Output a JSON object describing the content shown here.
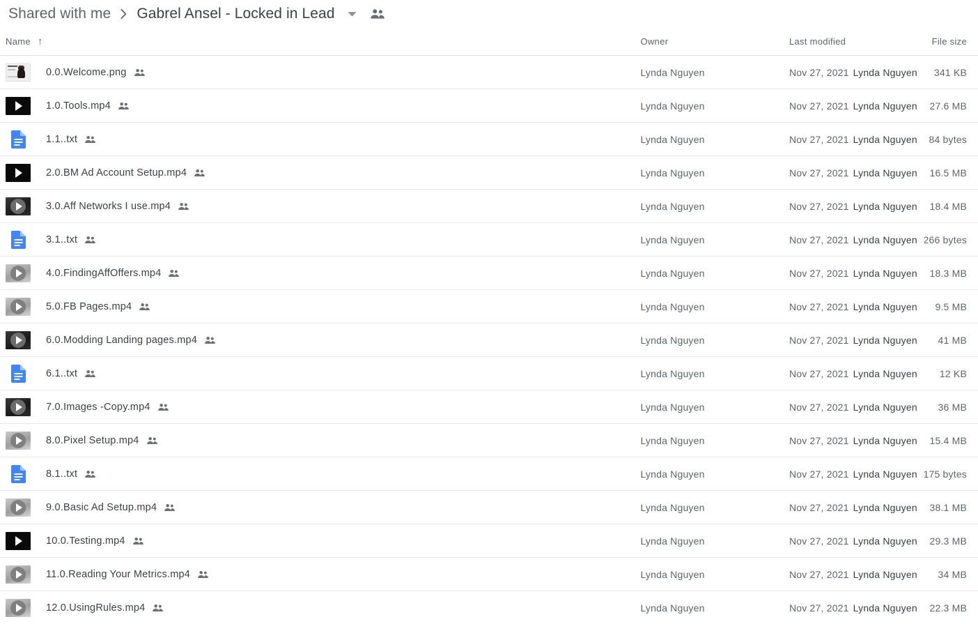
{
  "breadcrumb": {
    "root_label": "Shared with me",
    "separator": "›",
    "current_label": "Gabrel Ansel - Locked in Lead",
    "caret_icon": "chevron-down-icon",
    "people_icon": "people-icon"
  },
  "table": {
    "headers": {
      "name": "Name",
      "sort_arrow": "↑",
      "owner": "Owner",
      "modified": "Last modified",
      "size": "File size"
    },
    "rows": [
      {
        "name": "0.0.Welcome.png",
        "icon": "image-thumbnail",
        "owner": "Lynda Nguyen",
        "modified_date": "Nov 27, 2021",
        "modified_by": "Lynda Nguyen",
        "size": "341 KB"
      },
      {
        "name": "1.0.Tools.mp4",
        "icon": "video-dark",
        "owner": "Lynda Nguyen",
        "modified_date": "Nov 27, 2021",
        "modified_by": "Lynda Nguyen",
        "size": "27.6 MB"
      },
      {
        "name": "1.1..txt",
        "icon": "text-document-icon",
        "owner": "Lynda Nguyen",
        "modified_date": "Nov 27, 2021",
        "modified_by": "Lynda Nguyen",
        "size": "84 bytes"
      },
      {
        "name": "2.0.BM Ad Account Setup.mp4",
        "icon": "video-dark",
        "owner": "Lynda Nguyen",
        "modified_date": "Nov 27, 2021",
        "modified_by": "Lynda Nguyen",
        "size": "16.5 MB"
      },
      {
        "name": "3.0.Aff Networks I use.mp4",
        "icon": "video-mid",
        "owner": "Lynda Nguyen",
        "modified_date": "Nov 27, 2021",
        "modified_by": "Lynda Nguyen",
        "size": "18.4 MB"
      },
      {
        "name": "3.1..txt",
        "icon": "text-document-icon",
        "owner": "Lynda Nguyen",
        "modified_date": "Nov 27, 2021",
        "modified_by": "Lynda Nguyen",
        "size": "266 bytes"
      },
      {
        "name": "4.0.FindingAffOffers.mp4",
        "icon": "video-gray",
        "owner": "Lynda Nguyen",
        "modified_date": "Nov 27, 2021",
        "modified_by": "Lynda Nguyen",
        "size": "18.3 MB"
      },
      {
        "name": "5.0.FB Pages.mp4",
        "icon": "video-gray",
        "owner": "Lynda Nguyen",
        "modified_date": "Nov 27, 2021",
        "modified_by": "Lynda Nguyen",
        "size": "9.5 MB"
      },
      {
        "name": "6.0.Modding Landing pages.mp4",
        "icon": "video-mid",
        "owner": "Lynda Nguyen",
        "modified_date": "Nov 27, 2021",
        "modified_by": "Lynda Nguyen",
        "size": "41 MB"
      },
      {
        "name": "6.1..txt",
        "icon": "text-document-icon",
        "owner": "Lynda Nguyen",
        "modified_date": "Nov 27, 2021",
        "modified_by": "Lynda Nguyen",
        "size": "12 KB"
      },
      {
        "name": "7.0.Images -Copy.mp4",
        "icon": "video-mid",
        "owner": "Lynda Nguyen",
        "modified_date": "Nov 27, 2021",
        "modified_by": "Lynda Nguyen",
        "size": "36 MB"
      },
      {
        "name": "8.0.Pixel Setup.mp4",
        "icon": "video-gray",
        "owner": "Lynda Nguyen",
        "modified_date": "Nov 27, 2021",
        "modified_by": "Lynda Nguyen",
        "size": "15.4 MB"
      },
      {
        "name": "8.1..txt",
        "icon": "text-document-icon",
        "owner": "Lynda Nguyen",
        "modified_date": "Nov 27, 2021",
        "modified_by": "Lynda Nguyen",
        "size": "175 bytes"
      },
      {
        "name": "9.0.Basic Ad Setup.mp4",
        "icon": "video-gray",
        "owner": "Lynda Nguyen",
        "modified_date": "Nov 27, 2021",
        "modified_by": "Lynda Nguyen",
        "size": "38.1 MB"
      },
      {
        "name": "10.0.Testing.mp4",
        "icon": "video-dark",
        "owner": "Lynda Nguyen",
        "modified_date": "Nov 27, 2021",
        "modified_by": "Lynda Nguyen",
        "size": "29.3 MB"
      },
      {
        "name": "11.0.Reading Your Metrics.mp4",
        "icon": "video-gray",
        "owner": "Lynda Nguyen",
        "modified_date": "Nov 27, 2021",
        "modified_by": "Lynda Nguyen",
        "size": "34 MB"
      },
      {
        "name": "12.0.UsingRules.mp4",
        "icon": "video-gray",
        "owner": "Lynda Nguyen",
        "modified_date": "Nov 27, 2021",
        "modified_by": "Lynda Nguyen",
        "size": "22.3 MB"
      }
    ],
    "row_shared_icon": "people-icon"
  },
  "colors": {
    "text_primary": "#3c4043",
    "text_secondary": "#5f6368",
    "divider": "#e8eaed",
    "doc_blue": "#4285f4"
  }
}
